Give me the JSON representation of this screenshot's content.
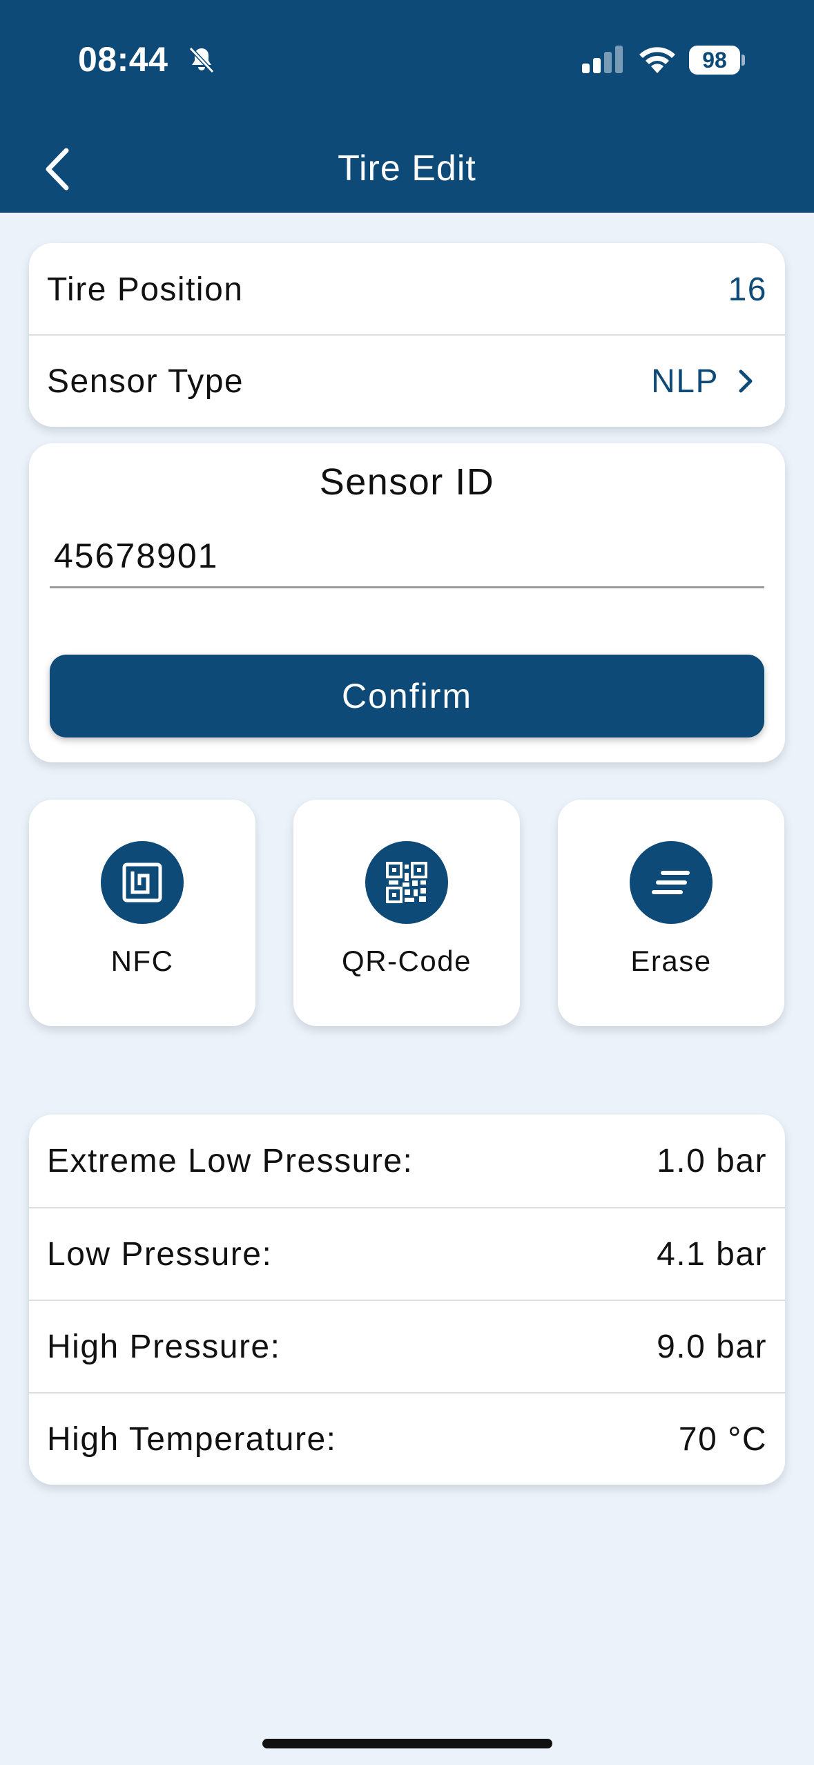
{
  "status_bar": {
    "time": "08:44",
    "battery": "98",
    "icons": [
      "bell-slash-icon",
      "signal-icon",
      "wifi-icon",
      "battery-icon"
    ]
  },
  "nav": {
    "title": "Tire Edit",
    "back_icon": "chevron-left-icon"
  },
  "tire_info": [
    {
      "label": "Tire Position",
      "value": "16"
    },
    {
      "label": "Sensor Type",
      "value": "NLP",
      "icon": "chevron-right-icon"
    }
  ],
  "sensor": {
    "title": "Sensor ID",
    "value": "45678901",
    "confirm_label": "Confirm"
  },
  "tools": [
    {
      "label": "NFC",
      "icon": "nfc-icon"
    },
    {
      "label": "QR-Code",
      "icon": "qr-code-icon"
    },
    {
      "label": "Erase",
      "icon": "erase-icon"
    }
  ],
  "thresholds": [
    {
      "label": "Extreme Low Pressure:",
      "value": "1.0 bar"
    },
    {
      "label": "Low Pressure:",
      "value": "4.1 bar"
    },
    {
      "label": "High Pressure:",
      "value": "9.0 bar"
    },
    {
      "label": "High Temperature:",
      "value": "70 °C"
    }
  ],
  "colors": {
    "primary": "#0E4A78",
    "background": "#EBF2FA",
    "card": "#FFFFFF"
  }
}
